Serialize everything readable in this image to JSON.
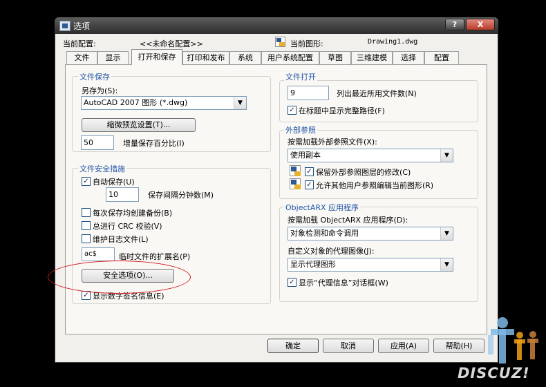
{
  "window": {
    "title": "选项",
    "help_glyph": "?",
    "close_glyph": "X"
  },
  "profile": {
    "label": "当前配置:",
    "value": "<<未命名配置>>"
  },
  "drawing": {
    "label": "当前图形:",
    "value": "Drawing1.dwg",
    "icon": "drawing-icon"
  },
  "tabs": [
    "文件",
    "显示",
    "打开和保存",
    "打印和发布",
    "系统",
    "用户系统配置",
    "草图",
    "三维建模",
    "选择",
    "配置"
  ],
  "active_tab": "打开和保存",
  "file_save": {
    "title": "文件保存",
    "saveas_label": "另存为(S):",
    "saveas_value": "AutoCAD 2007 图形 (*.dwg)",
    "thumb_button": "缩微预览设置(T)...",
    "incremental_value": "50",
    "incremental_label": "增量保存百分比(I)"
  },
  "safety": {
    "title": "文件安全措施",
    "autosave_label": "自动保存(U)",
    "autosave_checked": true,
    "minutes_value": "10",
    "minutes_label": "保存间隔分钟数(M)",
    "backup_label": "每次保存均创建备份(B)",
    "backup_checked": false,
    "crc_label": "总进行 CRC 校验(V)",
    "crc_checked": false,
    "log_label": "维护日志文件(L)",
    "log_checked": false,
    "ext_value": "ac$",
    "ext_label": "临时文件的扩展名(P)",
    "security_button": "安全选项(O)...",
    "signature_label": "显示数字签名信息(E)",
    "signature_checked": true
  },
  "file_open": {
    "title": "文件打开",
    "recent_value": "9",
    "recent_label": "列出最近所用文件数(N)",
    "fullpath_label": "在标题中显示完整路径(F)",
    "fullpath_checked": true
  },
  "xref": {
    "title": "外部参照",
    "demand_label": "按需加载外部参照文件(X):",
    "demand_value": "使用副本",
    "retain_label": "保留外部参照图层的修改(C)",
    "retain_checked": true,
    "allow_label": "允许其他用户参照编辑当前图形(R)",
    "allow_checked": true
  },
  "arx": {
    "title": "ObjectARX 应用程序",
    "demand_label": "按需加载 ObjectARX 应用程序(D):",
    "demand_value": "对象检测和命令调用",
    "proxy_label": "自定义对象的代理图像(J):",
    "proxy_value": "显示代理图形",
    "info_label": "显示“代理信息”对话框(W)",
    "info_checked": true
  },
  "buttons": {
    "ok": "确定",
    "cancel": "取消",
    "apply": "应用(A)",
    "help": "帮助(H)"
  },
  "watermark": {
    "text": "DISCUZ!"
  }
}
